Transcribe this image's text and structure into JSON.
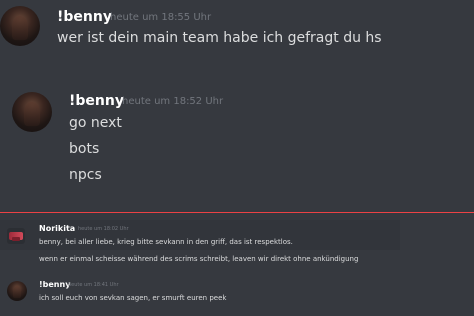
{
  "messages": [
    {
      "username": "!benny",
      "timestamp": "heute um 18:55 Uhr",
      "lines": [
        "wer ist dein main team habe ich gefragt du hs"
      ]
    },
    {
      "username": "!benny",
      "timestamp": "heute um 18:52 Uhr",
      "lines": [
        "go next",
        "bots",
        "npcs"
      ]
    },
    {
      "username": "Norikita",
      "timestamp": "heute um 18:02 Uhr",
      "lines": [
        "benny, bei aller liebe, krieg bitte sevkann in den griff, das ist respektlos.",
        "wenn er einmal scheisse während des scrims schreibt, leaven wir direkt ohne ankündigung"
      ]
    },
    {
      "username": "!benny",
      "timestamp": "heute um 18:41 Uhr",
      "lines": [
        "ich soll euch von sevkan sagen, er smurft euren peek"
      ]
    }
  ],
  "colors": {
    "background": "#36393f",
    "username": "#ffffff",
    "timestamp": "#72767d",
    "text": "#dcddde",
    "divider": "#ed4245"
  }
}
